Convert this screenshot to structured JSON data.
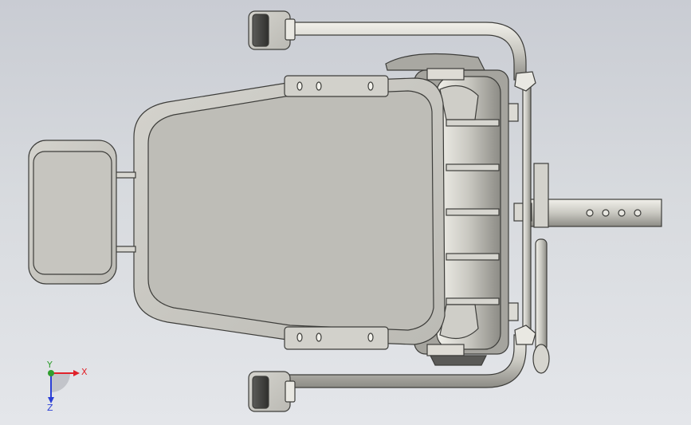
{
  "viewport": {
    "background_top": "#c9ccd3",
    "background_bottom": "#e4e6ea"
  },
  "model": {
    "part": "seat-assembly",
    "view": "top",
    "body_color": "#c2c1bb",
    "edge_color": "#3d3d3a"
  },
  "triad": {
    "x_label": "X",
    "y_label": "Y",
    "z_label": "Z",
    "x_color": "#e0222a",
    "y_color": "#2f9e2f",
    "z_color": "#2b3fd6"
  }
}
